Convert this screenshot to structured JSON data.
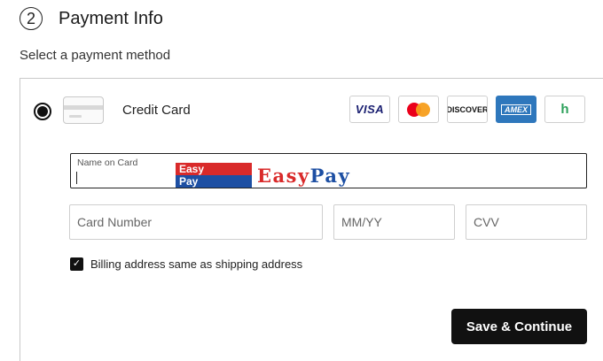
{
  "header": {
    "step_number": "2",
    "title": "Payment Info",
    "subtitle": "Select a payment method"
  },
  "payment_method": {
    "selected": true,
    "label": "Credit Card",
    "logos": {
      "visa": "VISA",
      "discover": "DISCOVER",
      "amex": "AMEX",
      "hb": "h"
    }
  },
  "form": {
    "name_label": "Name on Card",
    "name_value": "",
    "card_number_placeholder": "Card Number",
    "expiry_placeholder": "MM/YY",
    "cvv_placeholder": "CVV",
    "billing_checked": true,
    "billing_label": "Billing address same as shipping address"
  },
  "overlay": {
    "badge_top": "Easy",
    "badge_bottom": "Pay",
    "text_a": "Easy",
    "text_b": "Pay"
  },
  "actions": {
    "save_label": "Save & Continue"
  },
  "colors": {
    "primary_button": "#111111",
    "mc_red": "#eb001b",
    "mc_orange": "#f79e1b",
    "amex_blue": "#2e77bc",
    "easypay_red": "#d92a2a",
    "easypay_blue": "#1d4fa3"
  }
}
